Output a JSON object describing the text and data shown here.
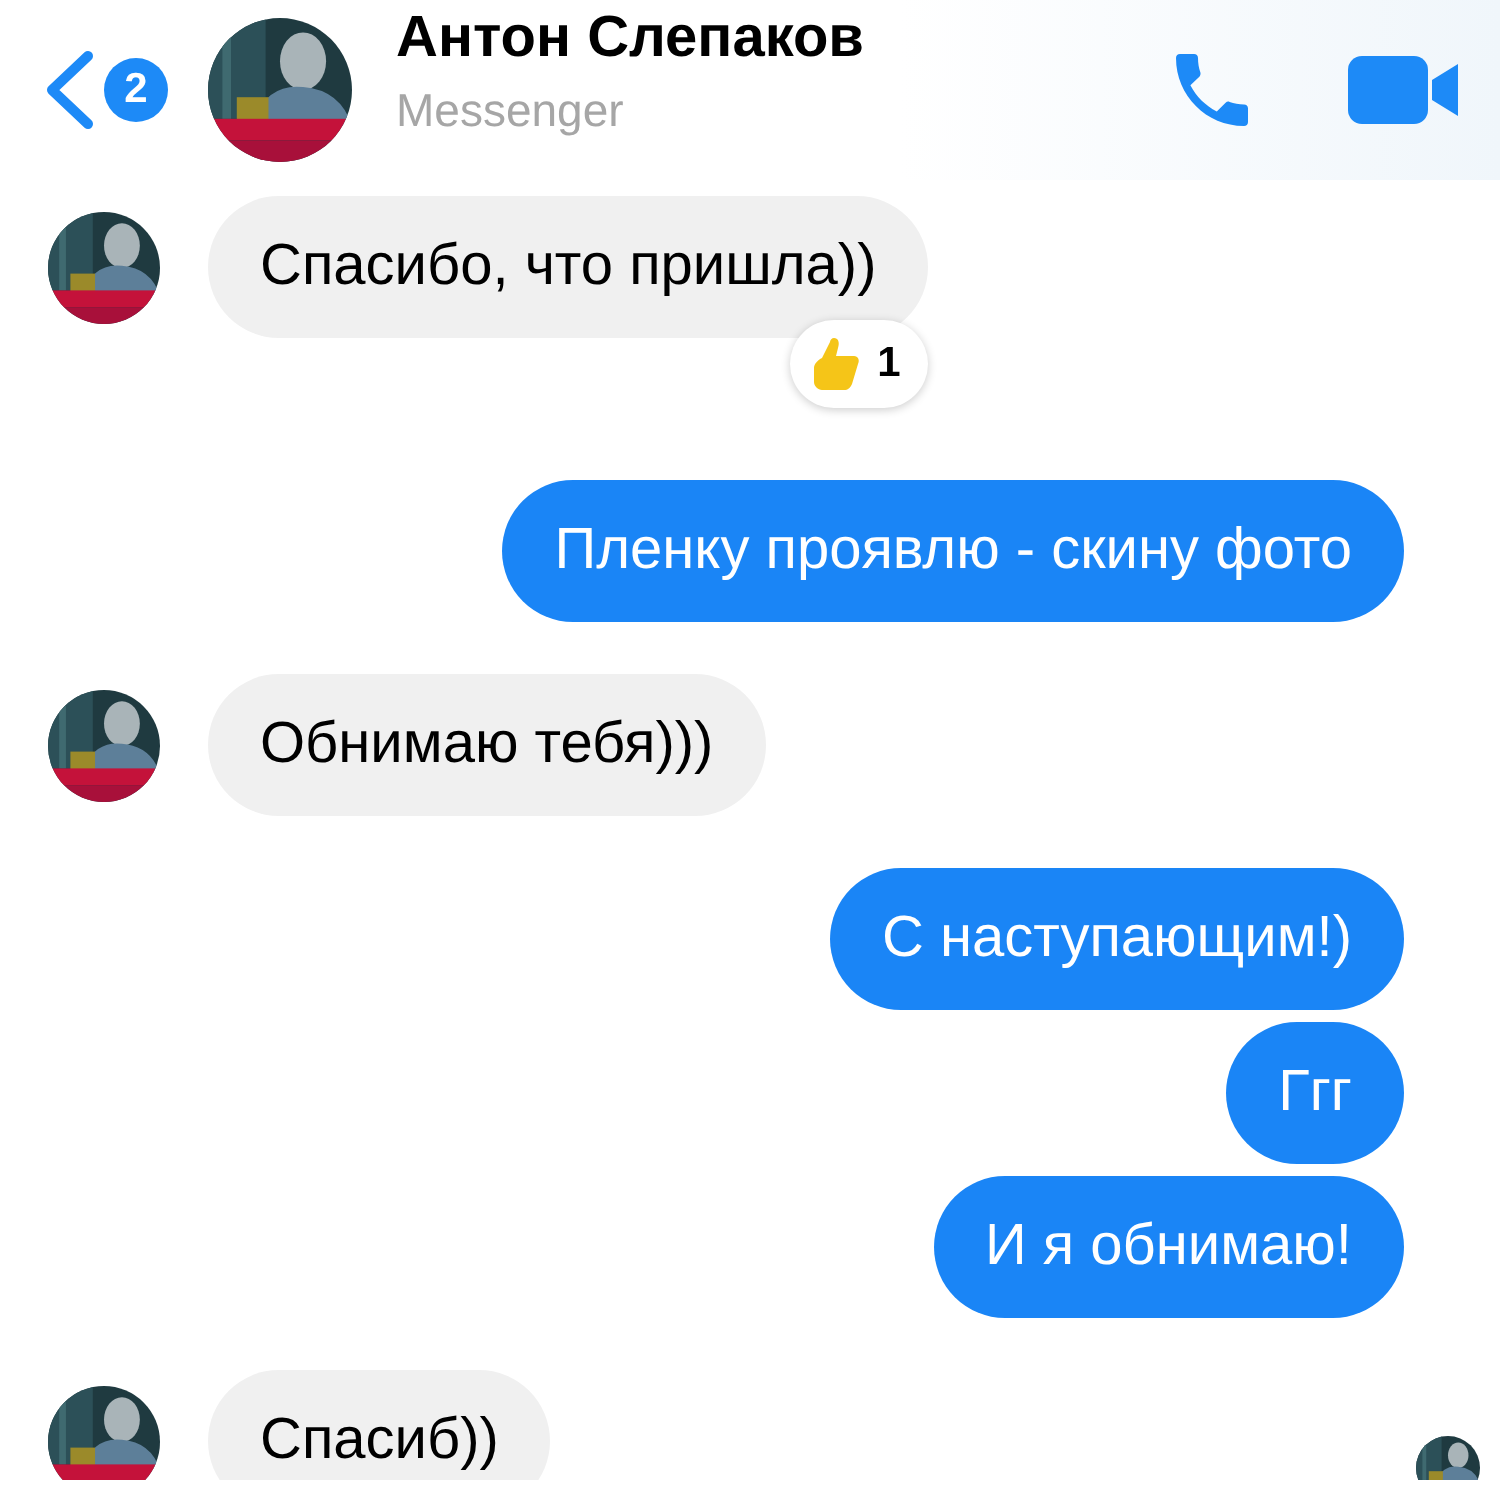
{
  "header": {
    "back_badge": "2",
    "name": "Антон Слепаков",
    "subtitle": "Messenger"
  },
  "messages": [
    {
      "kind": "incoming",
      "text": "Спасибо, что пришла))",
      "reaction": {
        "count": "1"
      }
    },
    {
      "kind": "outgoing",
      "text": "Пленку проявлю - скину фото"
    },
    {
      "kind": "incoming",
      "text": "Обнимаю тебя)))"
    },
    {
      "kind": "outgoing",
      "text": "С наступающим!)"
    },
    {
      "kind": "outgoing",
      "text": "Ггг"
    },
    {
      "kind": "outgoing",
      "text": "И я обнимаю!"
    },
    {
      "kind": "incoming",
      "text": "Спасиб))"
    }
  ]
}
